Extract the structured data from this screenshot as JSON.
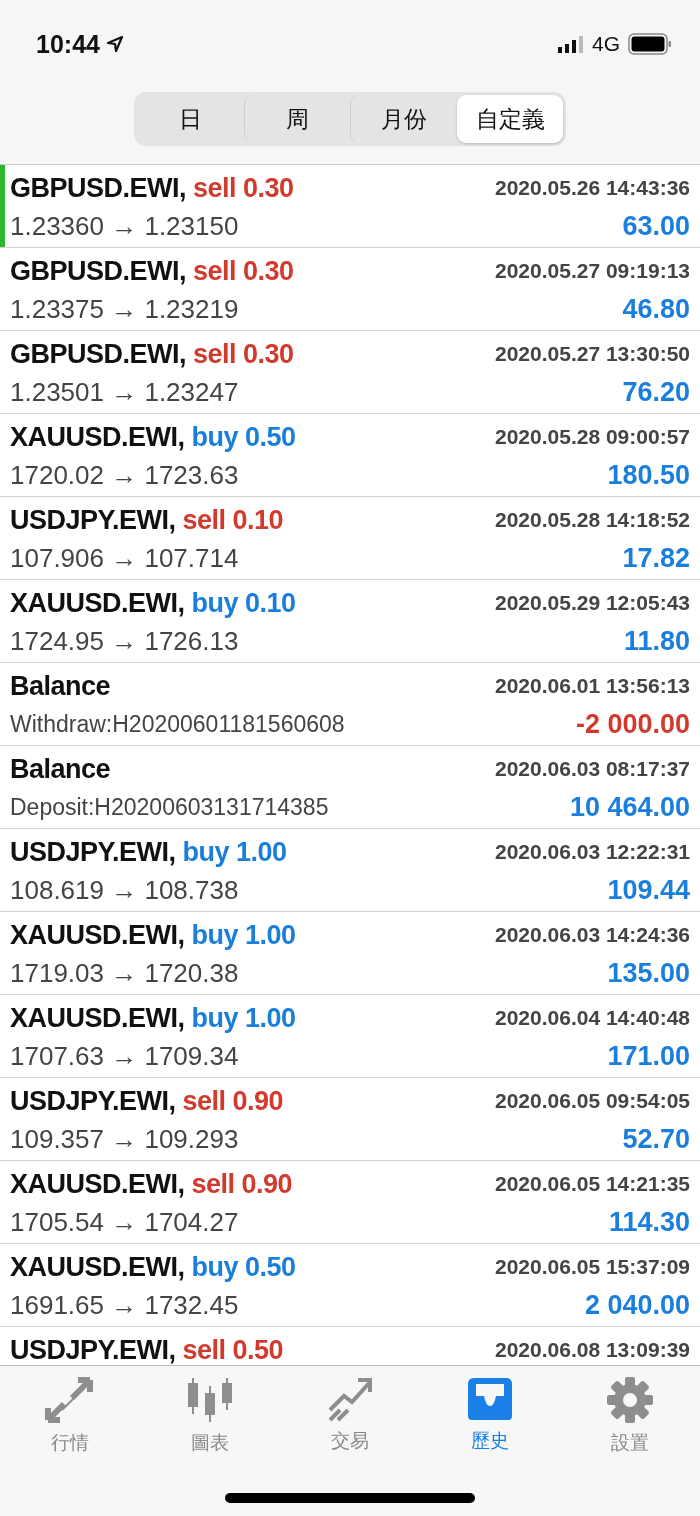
{
  "status_bar": {
    "time": "10:44",
    "network": "4G"
  },
  "segments": [
    {
      "label": "日",
      "selected": false
    },
    {
      "label": "周",
      "selected": false
    },
    {
      "label": "月份",
      "selected": false
    },
    {
      "label": "自定義",
      "selected": true
    }
  ],
  "rows": [
    {
      "kind": "trade",
      "symbol": "GBPUSD.EWI,",
      "order": {
        "text": "sell 0.30",
        "kind": "sell"
      },
      "time": "2020.05.26 14:43:36",
      "detail": "1.23360 → 1.23150",
      "amount": "63.00",
      "loss": false,
      "selected": true
    },
    {
      "kind": "trade",
      "symbol": "GBPUSD.EWI,",
      "order": {
        "text": "sell 0.30",
        "kind": "sell"
      },
      "time": "2020.05.27 09:19:13",
      "detail": "1.23375 → 1.23219",
      "amount": "46.80",
      "loss": false,
      "selected": false
    },
    {
      "kind": "trade",
      "symbol": "GBPUSD.EWI,",
      "order": {
        "text": "sell 0.30",
        "kind": "sell"
      },
      "time": "2020.05.27 13:30:50",
      "detail": "1.23501 → 1.23247",
      "amount": "76.20",
      "loss": false,
      "selected": false
    },
    {
      "kind": "trade",
      "symbol": "XAUUSD.EWI,",
      "order": {
        "text": "buy 0.50",
        "kind": "buy"
      },
      "time": "2020.05.28 09:00:57",
      "detail": "1720.02 → 1723.63",
      "amount": "180.50",
      "loss": false,
      "selected": false
    },
    {
      "kind": "trade",
      "symbol": "USDJPY.EWI,",
      "order": {
        "text": "sell 0.10",
        "kind": "sell"
      },
      "time": "2020.05.28 14:18:52",
      "detail": "107.906 → 107.714",
      "amount": "17.82",
      "loss": false,
      "selected": false
    },
    {
      "kind": "trade",
      "symbol": "XAUUSD.EWI,",
      "order": {
        "text": "buy 0.10",
        "kind": "buy"
      },
      "time": "2020.05.29 12:05:43",
      "detail": "1724.95 → 1726.13",
      "amount": "11.80",
      "loss": false,
      "selected": false
    },
    {
      "kind": "balance",
      "symbol": "Balance",
      "time": "2020.06.01 13:56:13",
      "detail": "Withdraw:H20200601181560608",
      "amount": "-2 000.00",
      "loss": true,
      "selected": false
    },
    {
      "kind": "balance",
      "symbol": "Balance",
      "time": "2020.06.03 08:17:37",
      "detail": "Deposit:H20200603131714385",
      "amount": "10 464.00",
      "loss": false,
      "selected": false
    },
    {
      "kind": "trade",
      "symbol": "USDJPY.EWI,",
      "order": {
        "text": "buy 1.00",
        "kind": "buy"
      },
      "time": "2020.06.03 12:22:31",
      "detail": "108.619 → 108.738",
      "amount": "109.44",
      "loss": false,
      "selected": false
    },
    {
      "kind": "trade",
      "symbol": "XAUUSD.EWI,",
      "order": {
        "text": "buy 1.00",
        "kind": "buy"
      },
      "time": "2020.06.03 14:24:36",
      "detail": "1719.03 → 1720.38",
      "amount": "135.00",
      "loss": false,
      "selected": false
    },
    {
      "kind": "trade",
      "symbol": "XAUUSD.EWI,",
      "order": {
        "text": "buy 1.00",
        "kind": "buy"
      },
      "time": "2020.06.04 14:40:48",
      "detail": "1707.63 → 1709.34",
      "amount": "171.00",
      "loss": false,
      "selected": false
    },
    {
      "kind": "trade",
      "symbol": "USDJPY.EWI,",
      "order": {
        "text": "sell 0.90",
        "kind": "sell"
      },
      "time": "2020.06.05 09:54:05",
      "detail": "109.357 → 109.293",
      "amount": "52.70",
      "loss": false,
      "selected": false
    },
    {
      "kind": "trade",
      "symbol": "XAUUSD.EWI,",
      "order": {
        "text": "sell 0.90",
        "kind": "sell"
      },
      "time": "2020.06.05 14:21:35",
      "detail": "1705.54 → 1704.27",
      "amount": "114.30",
      "loss": false,
      "selected": false
    },
    {
      "kind": "trade",
      "symbol": "XAUUSD.EWI,",
      "order": {
        "text": "buy 0.50",
        "kind": "buy"
      },
      "time": "2020.06.05 15:37:09",
      "detail": "1691.65 → 1732.45",
      "amount": "2 040.00",
      "loss": false,
      "selected": false
    },
    {
      "kind": "trade",
      "symbol": "USDJPY.EWI,",
      "order": {
        "text": "sell 0.50",
        "kind": "sell"
      },
      "time": "2020.06.08 13:09:39",
      "selected": false
    }
  ],
  "tab_bar": [
    {
      "label": "行情",
      "selected": false
    },
    {
      "label": "圖表",
      "selected": false
    },
    {
      "label": "交易",
      "selected": false
    },
    {
      "label": "歷史",
      "selected": true
    },
    {
      "label": "設置",
      "selected": false
    }
  ]
}
